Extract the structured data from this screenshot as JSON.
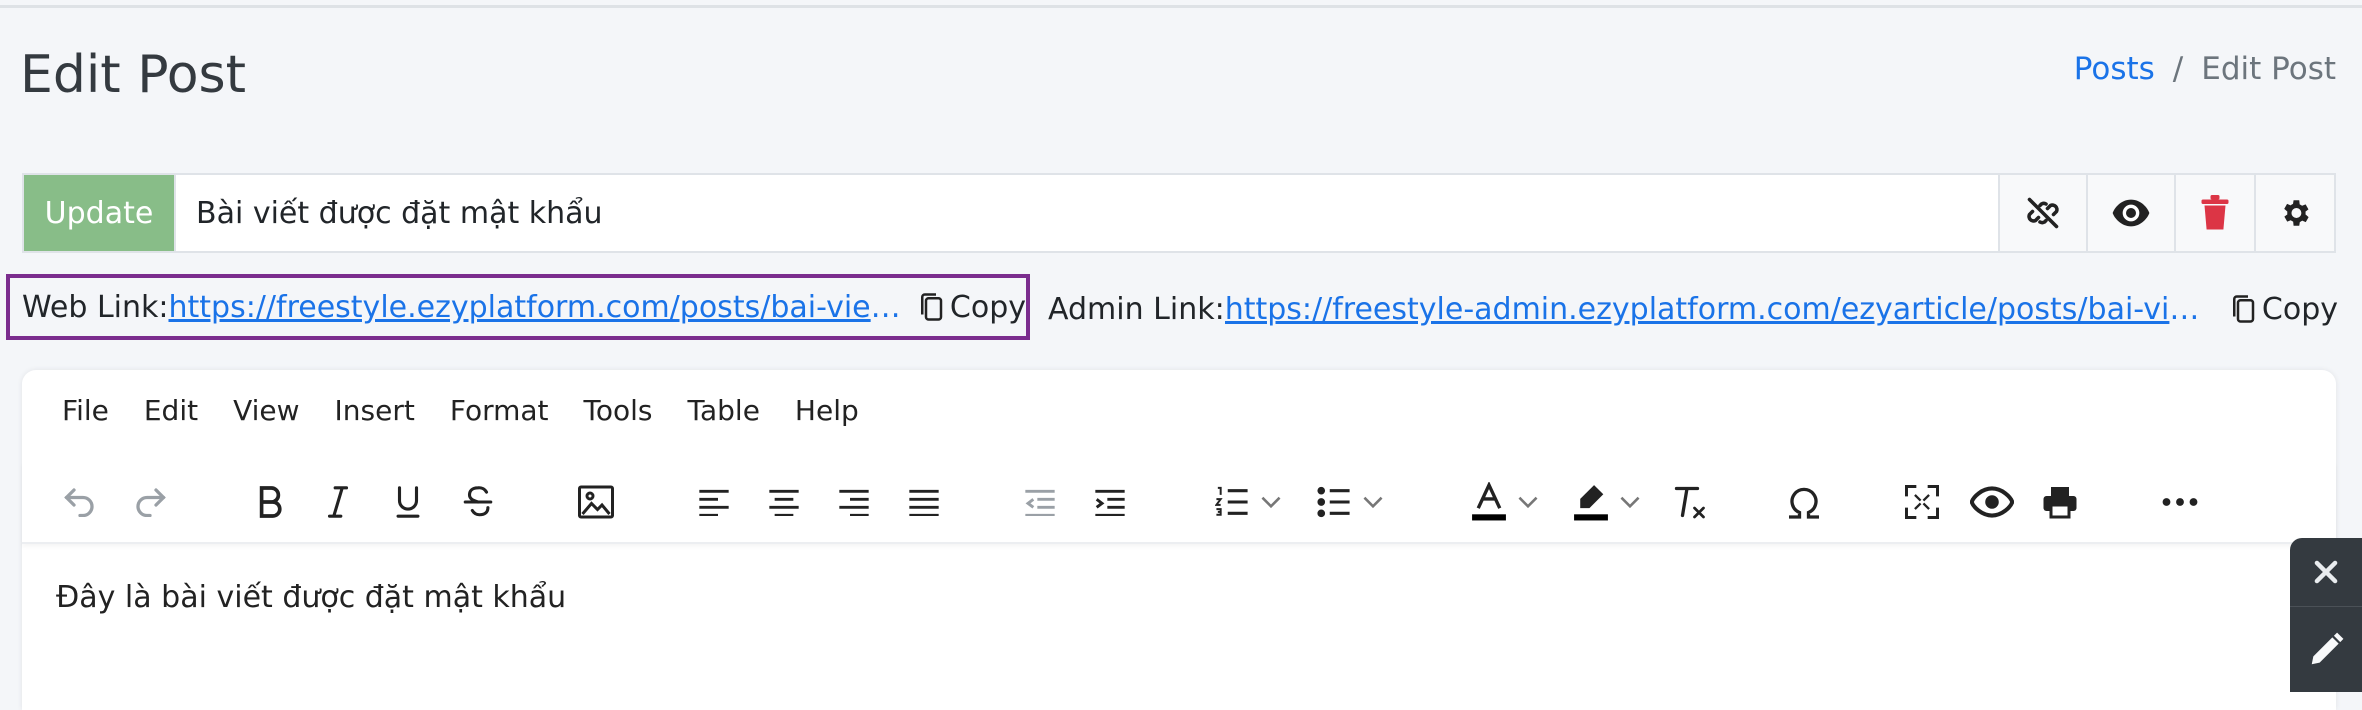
{
  "header": {
    "title": "Edit Post",
    "breadcrumb": {
      "parent": "Posts",
      "separator": "/",
      "current": "Edit Post"
    }
  },
  "title_bar": {
    "update_label": "Update",
    "title_value": "Bài viết được đặt mật khẩu",
    "icons": [
      "unlink-icon",
      "eye-icon",
      "trash-icon",
      "gear-icon"
    ]
  },
  "links": {
    "web_label": "Web Link:",
    "web_url": "https://freestyle.ezyplatform.com/posts/bai-viet-duoc-dat-mat-khau",
    "admin_label": "Admin Link:",
    "admin_url": "https://freestyle-admin.ezyplatform.com/ezyarticle/posts/bai-viet-duoc-dat-mat-khau",
    "copy_label": "Copy"
  },
  "editor": {
    "menu": [
      "File",
      "Edit",
      "View",
      "Insert",
      "Format",
      "Tools",
      "Table",
      "Help"
    ],
    "content": "Đây là bài viết được đặt mật khẩu"
  },
  "colors": {
    "update_bg": "#88bd88",
    "link": "#1a73e8",
    "highlight_border": "#7b2d8e",
    "delete": "#dc3545",
    "side_panel": "#343a40"
  }
}
